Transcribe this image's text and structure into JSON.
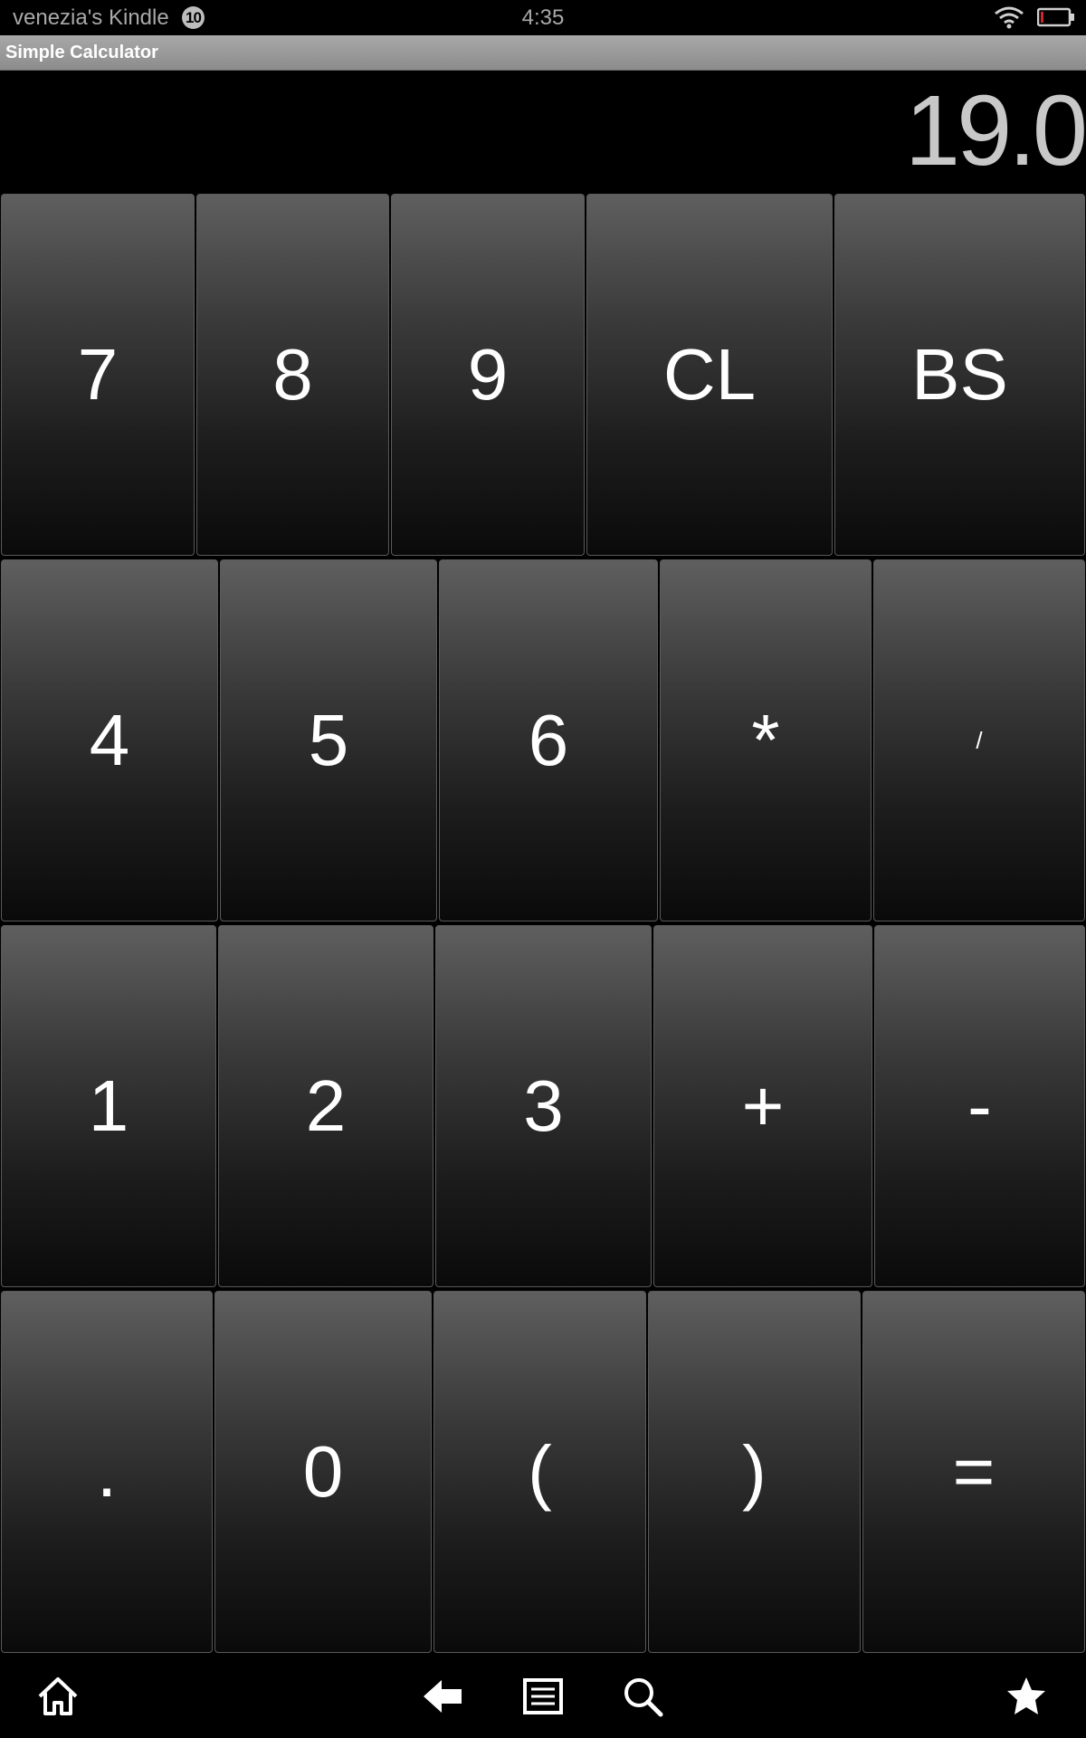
{
  "status_bar": {
    "device_name": "venezia's Kindle",
    "notification_count": "10",
    "time": "4:35"
  },
  "app": {
    "title": "Simple Calculator"
  },
  "display": {
    "value": "19.0"
  },
  "keypad": {
    "rows": [
      [
        "7",
        "8",
        "9",
        "CL",
        "BS"
      ],
      [
        "4",
        "5",
        "6",
        "*",
        "/"
      ],
      [
        "1",
        "2",
        "3",
        "+",
        "-"
      ],
      [
        ".",
        "0",
        "(",
        ")",
        "="
      ]
    ]
  },
  "nav_bar": {
    "icons": [
      "home-icon",
      "back-icon",
      "menu-icon",
      "search-icon",
      "favorites-icon"
    ]
  },
  "colors": {
    "background": "#000000",
    "title_bar": "#9a9a9a",
    "display_text": "#c8c8c8",
    "key_top": "#5f5f5f",
    "key_bottom": "#0a0a0a"
  }
}
